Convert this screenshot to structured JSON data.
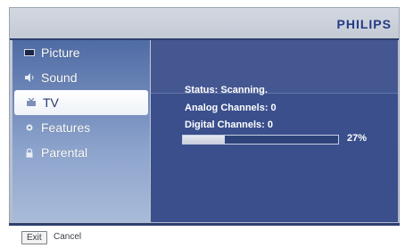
{
  "brand": "PHILIPS",
  "menu": {
    "items": [
      {
        "label": "Picture",
        "icon": "monitor-icon"
      },
      {
        "label": "Sound",
        "icon": "speaker-icon"
      },
      {
        "label": "TV",
        "icon": "tv-icon",
        "selected": true
      },
      {
        "label": "Features",
        "icon": "gear-icon"
      },
      {
        "label": "Parental",
        "icon": "lock-icon"
      }
    ]
  },
  "content": {
    "status": "Status: Scanning.",
    "analog": "Analog Channels: 0",
    "digital": "Digital Channels: 0",
    "progress_value": 0.27,
    "progress_label": "27%"
  },
  "footer": {
    "exit_label": "Exit",
    "cancel_label": "Cancel"
  },
  "colors": {
    "accent": "#253a84",
    "panel": "#3a4f8c"
  }
}
